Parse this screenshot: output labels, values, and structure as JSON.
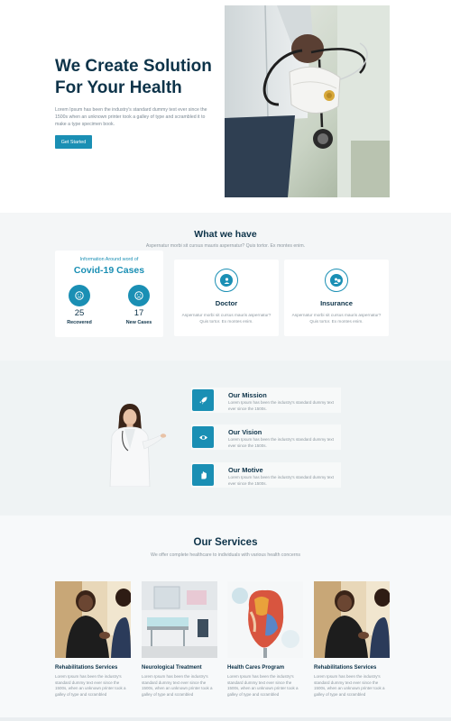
{
  "hero": {
    "title_line1": "We Create Solution",
    "title_line2": "For Your Health",
    "description": "Lorem Ipsum has been the industry's standard dummy text ever since the 1500s when an unknown printer took a galley of type and scrambled it to make a type specimen book.",
    "cta_label": "Get Started"
  },
  "what_we_have": {
    "title": "What we have",
    "subtitle": "Aspernatur morbi sit cursus mauris aspernatur? Quis tortor. Ex montes enim.",
    "covid": {
      "info": "Information Around word of",
      "title": "Covid-19 Cases",
      "recovered_count": "25",
      "recovered_label": "Recovered",
      "new_count": "17",
      "new_label": "New Cases"
    },
    "cards": [
      {
        "title": "Doctor",
        "description": "Aspernatur morbi sit cursus mauris aspernatur? Quis tortor. Ex montes enim.",
        "icon": "doctor-icon"
      },
      {
        "title": "Insurance",
        "description": "Aspernatur morbi sit cursus mauris aspernatur? Quis tortor. Ex montes enim.",
        "icon": "insurance-icon"
      }
    ]
  },
  "mission": {
    "items": [
      {
        "title": "Our Mission",
        "text": "Lorem Ipsum has been the industry's standard dummy text ever since the 1500s.",
        "icon": "rocket-icon"
      },
      {
        "title": "Our Vision",
        "text": "Lorem Ipsum has been the industry's standard dummy text ever since the 1500s.",
        "icon": "eye-icon"
      },
      {
        "title": "Our Motive",
        "text": "Lorem Ipsum has been the industry's standard dummy text ever since the 1500s.",
        "icon": "hand-icon"
      }
    ]
  },
  "services": {
    "title": "Our Services",
    "subtitle": "We offer complete healthcare to individuals with various health concerns",
    "items": [
      {
        "title": "Rehabilitations Services",
        "description": "Lorem Ipsum has been the industry's standard dummy text ever since the 1500s, when an unknown printer took a galley of type and scrambled"
      },
      {
        "title": "Neurological Treatment",
        "description": "Lorem Ipsum has been the industry's standard dummy text ever since the 1500s, when an unknown printer took a galley of type and scrambled"
      },
      {
        "title": "Health Cares Program",
        "description": "Lorem Ipsum has been the industry's standard dummy text ever since the 1500s, when an unknown printer took a galley of type and scrambled"
      },
      {
        "title": "Rehabilitations Services",
        "description": "Lorem Ipsum has been the industry's standard dummy text ever since the 1500s, when an unknown printer took a galley of type and scrambled"
      }
    ]
  },
  "colors": {
    "accent": "#1a8fb4",
    "heading": "#0d3349",
    "muted": "#8c979f",
    "section_bg": "#f4f6f7"
  }
}
